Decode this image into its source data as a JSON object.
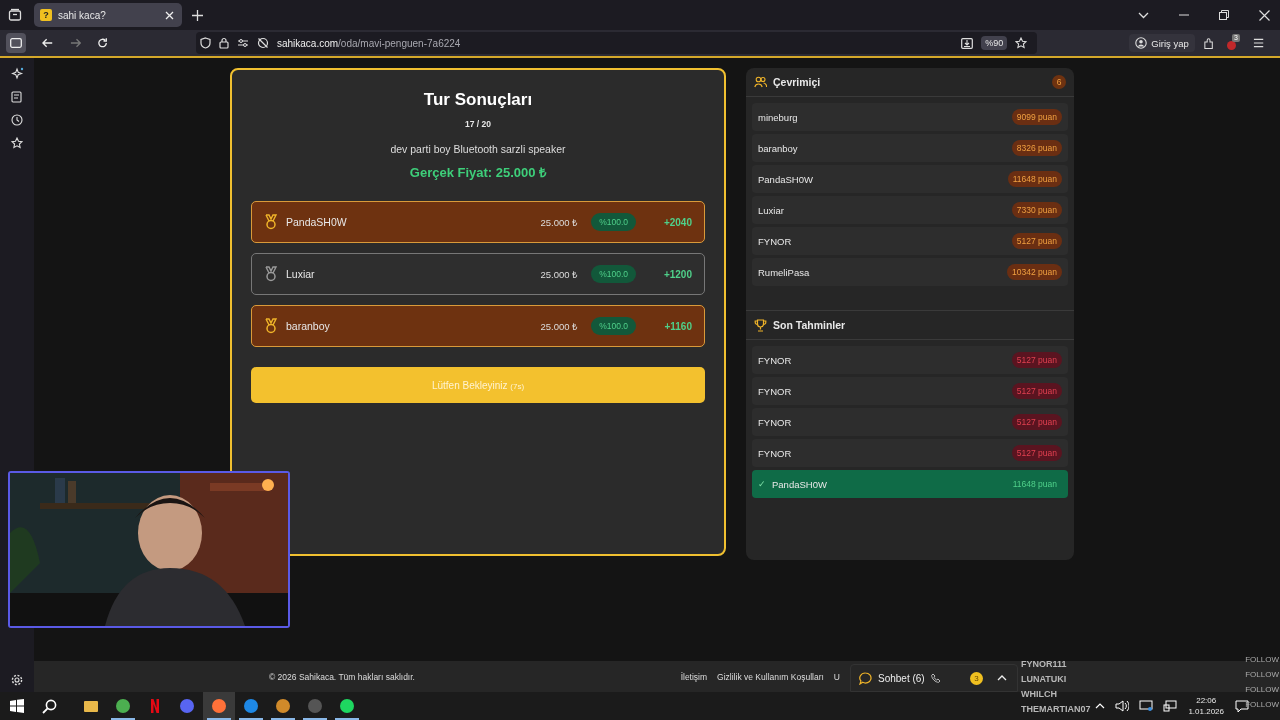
{
  "browser": {
    "tab": {
      "title": "sahi kaca?",
      "favicon": "?"
    },
    "url": {
      "domain": "sahikaca.com",
      "path": "/oda/mavi-penguen-7a6224"
    },
    "zoom": "%90",
    "signin": "Giriş yap",
    "extension_badge": "3"
  },
  "round": {
    "title": "Tur Sonuçları",
    "progress": "17 / 20",
    "product": "dev parti boy Bluetooth sarzli speaker",
    "price": "Gerçek Fiyat: 25.000 ₺",
    "results": [
      {
        "kind": "gold",
        "name": "PandaSH0W",
        "guess": "25.000 ₺",
        "accuracy": "%100.0",
        "points": "+2040"
      },
      {
        "kind": "silver",
        "name": "Luxiar",
        "guess": "25.000 ₺",
        "accuracy": "%100.0",
        "points": "+1200"
      },
      {
        "kind": "bronze",
        "name": "baranboy",
        "guess": "25.000 ₺",
        "accuracy": "%100.0",
        "points": "+1160"
      }
    ],
    "wait_button": {
      "label": "Lütfen Bekleyiniz",
      "countdown": "(7s)"
    }
  },
  "online": {
    "title": "Çevrimiçi",
    "count": "6",
    "players": [
      {
        "name": "mineburg",
        "score": "9099 puan"
      },
      {
        "name": "baranboy",
        "score": "8326 puan"
      },
      {
        "name": "PandaSH0W",
        "score": "11648 puan"
      },
      {
        "name": "Luxiar",
        "score": "7330 puan"
      },
      {
        "name": "FYNOR",
        "score": "5127 puan"
      },
      {
        "name": "RumeliPasa",
        "score": "10342 puan"
      }
    ]
  },
  "recent_guesses": {
    "title": "Son Tahminler",
    "items": [
      {
        "name": "FYNOR",
        "score": "5127 puan",
        "correct": false
      },
      {
        "name": "FYNOR",
        "score": "5127 puan",
        "correct": false
      },
      {
        "name": "FYNOR",
        "score": "5127 puan",
        "correct": false
      },
      {
        "name": "FYNOR",
        "score": "5127 puan",
        "correct": false
      },
      {
        "name": "PandaSH0W",
        "score": "11648 puan",
        "correct": true,
        "mark": "✓"
      }
    ]
  },
  "footer": {
    "copyright": "© 2026 Sahikaca. Tüm hakları saklıdır.",
    "links": [
      "İletişim",
      "Gizlilik ve Kullanım Koşulları",
      "U"
    ]
  },
  "chat": {
    "label": "Sohbet (6)",
    "badge": "3"
  },
  "stream_overlay": {
    "names": [
      "FYNOR111",
      "LUNATUKI",
      "WHILCH",
      "THEMARTIAN07"
    ],
    "follow": [
      "FOLLOW",
      "FOLLOW",
      "FOLLOW",
      "FOLLOW"
    ]
  },
  "taskbar": {
    "apps": [
      {
        "kind": "files",
        "running": false,
        "selected": false
      },
      {
        "kind": "chrome",
        "running": true,
        "selected": false
      },
      {
        "kind": "netflix",
        "running": false,
        "selected": false
      },
      {
        "kind": "discord",
        "running": false,
        "selected": false
      },
      {
        "kind": "firefox",
        "running": true,
        "selected": true
      },
      {
        "kind": "g",
        "running": true,
        "selected": false
      },
      {
        "kind": "m2",
        "running": true,
        "selected": false
      },
      {
        "kind": "obs",
        "running": true,
        "selected": false
      },
      {
        "kind": "spotify",
        "running": true,
        "selected": false
      }
    ],
    "time": "22:06",
    "date": "1.01.2026"
  }
}
